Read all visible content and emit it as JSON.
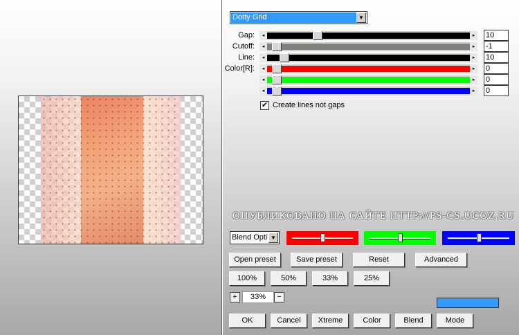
{
  "filter": {
    "selected": "Dotty Grid"
  },
  "sliders": [
    {
      "label": "Gap:",
      "value": "10",
      "fill": "#000000",
      "level": 0.21
    },
    {
      "label": "Cutoff:",
      "value": "-1",
      "fill": "#808080",
      "level": 0.0
    },
    {
      "label": "Line:",
      "value": "10",
      "fill": "#000000",
      "level": 0.04
    },
    {
      "label": "Color[R]:",
      "value": "0",
      "fill": "#ff0000",
      "level": 0.0
    },
    {
      "label": "",
      "value": "0",
      "fill": "#00ff00",
      "level": 0.0
    },
    {
      "label": "",
      "value": "0",
      "fill": "#0000ff",
      "level": 0.0
    }
  ],
  "checkbox": {
    "label": "Create lines not gaps",
    "checked": true,
    "mark": "✔"
  },
  "watermark": "ОПУБЛИКОВАНО   НА САЙТЕ   HTTP://PS-CS.UCOZ.RU",
  "blend": {
    "selected": "Blend Options"
  },
  "swatches": [
    {
      "color": "#ff0000",
      "level": 0.5
    },
    {
      "color": "#00ff00",
      "level": 0.5
    },
    {
      "color": "#0000ff",
      "level": 0.5
    }
  ],
  "buttons": {
    "open_preset": "Open preset",
    "save_preset": "Save preset",
    "reset": "Reset",
    "advanced": "Advanced",
    "zoom_100": "100%",
    "zoom_50": "50%",
    "zoom_33": "33%",
    "zoom_25": "25%",
    "ok": "OK",
    "cancel": "Cancel",
    "xtreme": "Xtreme",
    "color": "Color",
    "blend": "Blend",
    "mode": "Mode"
  },
  "zoom": {
    "plus": "+",
    "minus": "−",
    "value": "33%"
  },
  "colors": {
    "accent": "#3399ff"
  },
  "icons": {
    "dropdown": "▼",
    "arrow_left": "◂",
    "arrow_right": "▸"
  }
}
